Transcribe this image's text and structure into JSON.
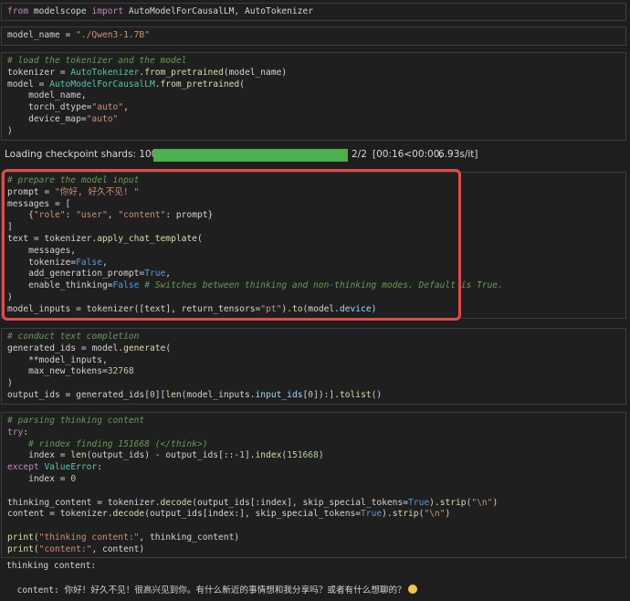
{
  "cells": [
    {
      "id": "import",
      "lines": [
        [
          [
            "kw",
            "from "
          ],
          [
            "pl",
            "modelscope "
          ],
          [
            "kw",
            "import "
          ],
          [
            "pl",
            "AutoModelForCausalLM, AutoTokenizer"
          ]
        ]
      ]
    },
    {
      "id": "model-name",
      "lines": [
        [
          [
            "pl",
            "model_name "
          ],
          [
            "pl",
            "= "
          ],
          [
            "st",
            "\"./Qwen3-1.7B\""
          ]
        ]
      ]
    },
    {
      "id": "load",
      "lines": [
        [
          [
            "cm",
            "# load the tokenizer and the model"
          ]
        ],
        [
          [
            "pl",
            "tokenizer "
          ],
          [
            "pl",
            "= "
          ],
          [
            "fn",
            "AutoTokenizer"
          ],
          [
            "pl",
            "."
          ],
          [
            "fc",
            "from_pretrained"
          ],
          [
            "pl",
            "(model_name)"
          ]
        ],
        [
          [
            "pl",
            "model "
          ],
          [
            "pl",
            "= "
          ],
          [
            "fn",
            "AutoModelForCausalLM"
          ],
          [
            "pl",
            "."
          ],
          [
            "fc",
            "from_pretrained"
          ],
          [
            "pl",
            "("
          ]
        ],
        [
          [
            "pl",
            "    model_name,"
          ]
        ],
        [
          [
            "pl",
            "    torch_dtype"
          ],
          [
            "pl",
            "="
          ],
          [
            "st",
            "\"auto\""
          ],
          [
            "pl",
            ","
          ]
        ],
        [
          [
            "pl",
            "    device_map"
          ],
          [
            "pl",
            "="
          ],
          [
            "st",
            "\"auto\""
          ]
        ],
        [
          [
            "pl",
            ")"
          ]
        ]
      ]
    },
    {
      "id": "prepare",
      "lines": [
        [
          [
            "cm",
            "# prepare the model input"
          ]
        ],
        [
          [
            "pl",
            "prompt "
          ],
          [
            "pl",
            "= "
          ],
          [
            "st",
            "\"你好, 好久不见! \""
          ]
        ],
        [
          [
            "pl",
            "messages "
          ],
          [
            "pl",
            "= ["
          ]
        ],
        [
          [
            "pl",
            "    {"
          ],
          [
            "st",
            "\"role\""
          ],
          [
            "pl",
            ": "
          ],
          [
            "st",
            "\"user\""
          ],
          [
            "pl",
            ", "
          ],
          [
            "st",
            "\"content\""
          ],
          [
            "pl",
            ": prompt}"
          ]
        ],
        [
          [
            "pl",
            "]"
          ]
        ],
        [
          [
            "pl",
            "text "
          ],
          [
            "pl",
            "= "
          ],
          [
            "pl",
            "tokenizer."
          ],
          [
            "fc",
            "apply_chat_template"
          ],
          [
            "pl",
            "("
          ]
        ],
        [
          [
            "pl",
            "    messages,"
          ]
        ],
        [
          [
            "pl",
            "    tokenize"
          ],
          [
            "pl",
            "="
          ],
          [
            "kb",
            "False"
          ],
          [
            "pl",
            ","
          ]
        ],
        [
          [
            "pl",
            "    add_generation_prompt"
          ],
          [
            "pl",
            "="
          ],
          [
            "kb",
            "True"
          ],
          [
            "pl",
            ","
          ]
        ],
        [
          [
            "pl",
            "    enable_thinking"
          ],
          [
            "pl",
            "="
          ],
          [
            "kb",
            "False "
          ],
          [
            "cm",
            "# Switches between thinking and non-thinking modes. Default is True."
          ]
        ],
        [
          [
            "pl",
            ")"
          ]
        ],
        [
          [
            "pl",
            "model_inputs "
          ],
          [
            "pl",
            "= "
          ],
          [
            "pl",
            "tokenizer([text], return_tensors"
          ],
          [
            "pl",
            "="
          ],
          [
            "st",
            "\"pt\""
          ],
          [
            "pl",
            ")."
          ],
          [
            "fc",
            "to"
          ],
          [
            "pl",
            "(model."
          ],
          [
            "vr",
            "device"
          ],
          [
            "pl",
            ")"
          ]
        ]
      ]
    },
    {
      "id": "generate",
      "lines": [
        [
          [
            "cm",
            "# conduct text completion"
          ]
        ],
        [
          [
            "pl",
            "generated_ids "
          ],
          [
            "pl",
            "= "
          ],
          [
            "pl",
            "model."
          ],
          [
            "fc",
            "generate"
          ],
          [
            "pl",
            "("
          ]
        ],
        [
          [
            "pl",
            "    **"
          ],
          [
            "pl",
            "model_inputs,"
          ]
        ],
        [
          [
            "pl",
            "    max_new_tokens"
          ],
          [
            "pl",
            "="
          ],
          [
            "nm",
            "32768"
          ]
        ],
        [
          [
            "pl",
            ")"
          ]
        ],
        [
          [
            "pl",
            "output_ids "
          ],
          [
            "pl",
            "= "
          ],
          [
            "pl",
            "generated_ids["
          ],
          [
            "nm",
            "0"
          ],
          [
            "pl",
            "]["
          ],
          [
            "fc",
            "len"
          ],
          [
            "pl",
            "(model_inputs."
          ],
          [
            "vr",
            "input_ids"
          ],
          [
            "pl",
            "["
          ],
          [
            "nm",
            "0"
          ],
          [
            "pl",
            "]):]."
          ],
          [
            "fc",
            "tolist"
          ],
          [
            "pl",
            "()"
          ]
        ]
      ]
    },
    {
      "id": "parse",
      "lines": [
        [
          [
            "cm",
            "# parsing thinking content"
          ]
        ],
        [
          [
            "kw",
            "try"
          ],
          [
            "pl",
            ":"
          ]
        ],
        [
          [
            "pl",
            "    "
          ],
          [
            "cm",
            "# rindex finding 151668 (</think>)"
          ]
        ],
        [
          [
            "pl",
            "    index "
          ],
          [
            "pl",
            "= "
          ],
          [
            "fc",
            "len"
          ],
          [
            "pl",
            "(output_ids) "
          ],
          [
            "pl",
            "- "
          ],
          [
            "pl",
            "output_ids[::"
          ],
          [
            "pl",
            "-"
          ],
          [
            "nm",
            "1"
          ],
          [
            "pl",
            "]."
          ],
          [
            "fc",
            "index"
          ],
          [
            "pl",
            "("
          ],
          [
            "nm",
            "151668"
          ],
          [
            "pl",
            ")"
          ]
        ],
        [
          [
            "kw",
            "except "
          ],
          [
            "fn",
            "ValueError"
          ],
          [
            "pl",
            ":"
          ]
        ],
        [
          [
            "pl",
            "    index "
          ],
          [
            "pl",
            "= "
          ],
          [
            "nm",
            "0"
          ]
        ],
        [
          [
            "pl",
            ""
          ]
        ],
        [
          [
            "pl",
            "thinking_content "
          ],
          [
            "pl",
            "= "
          ],
          [
            "pl",
            "tokenizer."
          ],
          [
            "fc",
            "decode"
          ],
          [
            "pl",
            "(output_ids[:index], skip_special_tokens"
          ],
          [
            "pl",
            "="
          ],
          [
            "kb",
            "True"
          ],
          [
            "pl",
            ")."
          ],
          [
            "fc",
            "strip"
          ],
          [
            "pl",
            "("
          ],
          [
            "st",
            "\"\\n\""
          ],
          [
            "pl",
            ")"
          ]
        ],
        [
          [
            "pl",
            "content "
          ],
          [
            "pl",
            "= "
          ],
          [
            "pl",
            "tokenizer."
          ],
          [
            "fc",
            "decode"
          ],
          [
            "pl",
            "(output_ids[index:], skip_special_tokens"
          ],
          [
            "pl",
            "="
          ],
          [
            "kb",
            "True"
          ],
          [
            "pl",
            ")."
          ],
          [
            "fc",
            "strip"
          ],
          [
            "pl",
            "("
          ],
          [
            "st",
            "\"\\n\""
          ],
          [
            "pl",
            ")"
          ]
        ],
        [
          [
            "pl",
            ""
          ]
        ],
        [
          [
            "fc",
            "print"
          ],
          [
            "pl",
            "("
          ],
          [
            "st",
            "\"thinking content:\""
          ],
          [
            "pl",
            ", thinking_content)"
          ]
        ],
        [
          [
            "fc",
            "print"
          ],
          [
            "pl",
            "("
          ],
          [
            "st",
            "\"content:\""
          ],
          [
            "pl",
            ", content)"
          ]
        ]
      ]
    }
  ],
  "progress": {
    "label": "Loading checkpoint shards: 100%",
    "fraction": 1.0,
    "count": "2/2",
    "timing": "[00:16<00:00,",
    "rate": "6.93s/it]",
    "color": "#4caf50"
  },
  "output": {
    "line1": "thinking content:",
    "line2": "content: 你好！好久不见！很高兴见到你。有什么新近的事情想和我分享吗？或者有什么想聊的？",
    "emoji_name": "smiley-emoji-icon"
  },
  "highlight_color": "#e34a4a"
}
